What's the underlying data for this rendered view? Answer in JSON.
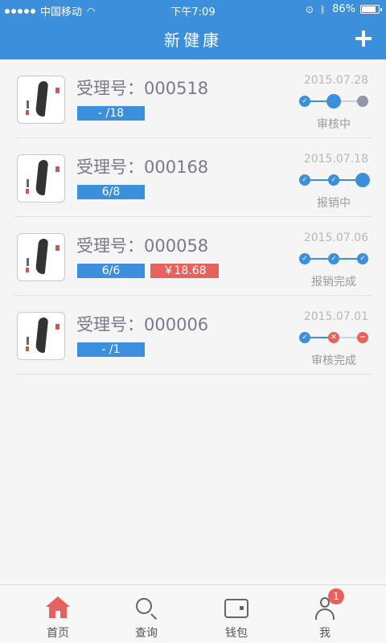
{
  "status_bar": {
    "carrier": "中国移动",
    "time": "下午7:09",
    "battery": "86%",
    "battery_level": 0.86
  },
  "header": {
    "title": "新健康",
    "add_icon": "plus-icon"
  },
  "records": [
    {
      "acceptance_label": "受理号：000518",
      "badge_blue": "- /18",
      "badge_red": null,
      "date": "2015.07.28",
      "status": "审核中",
      "progress_nodes": [
        "done",
        "current",
        "pending"
      ],
      "progress_done": 0.5
    },
    {
      "acceptance_label": "受理号：000168",
      "badge_blue": "6/8",
      "badge_red": null,
      "date": "2015.07.18",
      "status": "报销中",
      "progress_nodes": [
        "done",
        "done",
        "current"
      ],
      "progress_done": 1
    },
    {
      "acceptance_label": "受理号：000058",
      "badge_blue": "6/6",
      "badge_red": "￥18.68",
      "date": "2015.07.06",
      "status": "报销完成",
      "progress_nodes": [
        "done",
        "done",
        "done"
      ],
      "progress_done": 1
    },
    {
      "acceptance_label": "受理号：000006",
      "badge_blue": "- /1",
      "badge_red": null,
      "date": "2015.07.01",
      "status": "审核完成",
      "progress_nodes": [
        "done",
        "failed",
        "rejected"
      ],
      "progress_done": 0.5
    }
  ],
  "tabbar": {
    "tabs": [
      {
        "label": "首页",
        "icon": "home-icon",
        "active": true
      },
      {
        "label": "查询",
        "icon": "search-icon",
        "active": false
      },
      {
        "label": "钱包",
        "icon": "wallet-icon",
        "active": false
      },
      {
        "label": "我",
        "icon": "user-icon",
        "active": false,
        "badge": "1"
      }
    ]
  },
  "colors": {
    "primary": "#3b8fdb",
    "accent_red": "#e8625d"
  }
}
